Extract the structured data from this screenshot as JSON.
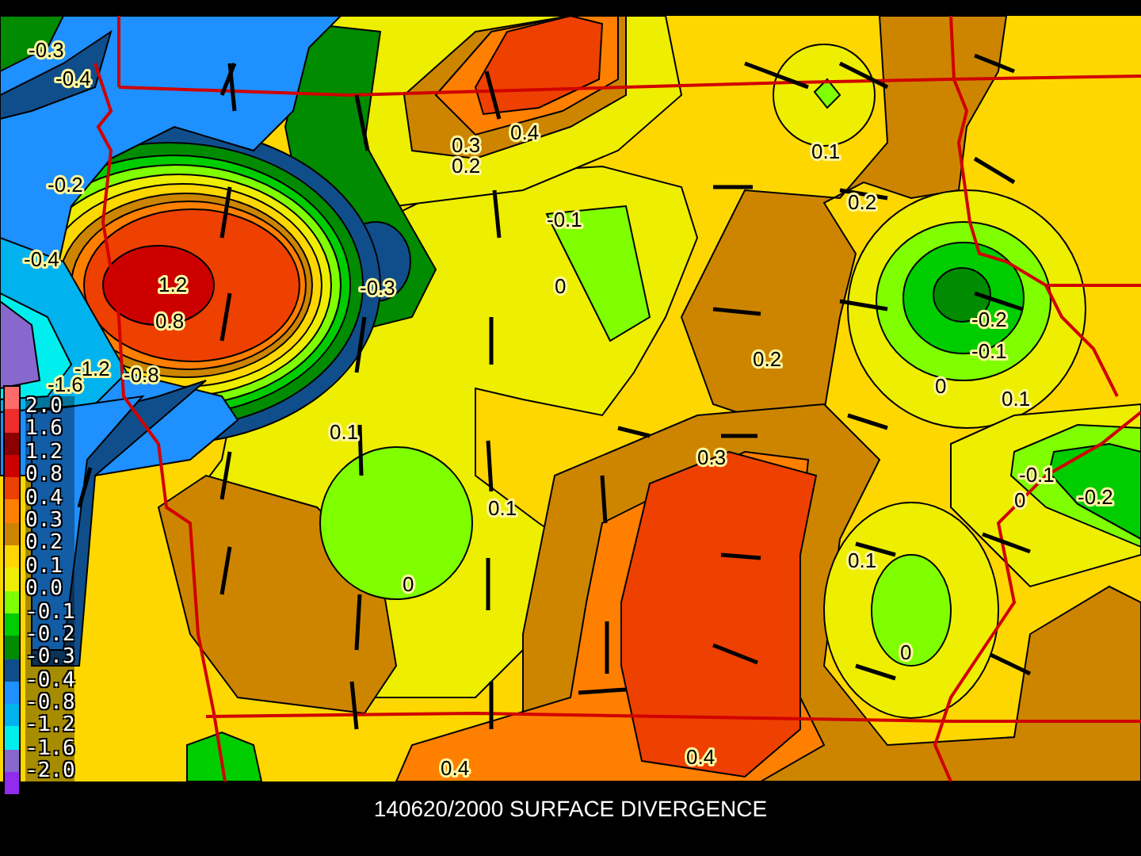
{
  "map": {
    "contour_labels": [
      "-0.3",
      "-0.4",
      "-0.2",
      "-0.4",
      "1.2",
      "0.8",
      "-0.3",
      "0.4",
      "0.3",
      "0.2",
      "-0.1",
      "0",
      "-1.2",
      "-1.6",
      "-0.8",
      "0.1",
      "0.2",
      "-0.2",
      "-0.1",
      "0",
      "0.1",
      "0.2",
      "0.1",
      "0.1",
      "0",
      "0.3",
      "-0.1",
      "0",
      "-0.2",
      "0.1",
      "0",
      "0.4",
      "0.4"
    ]
  },
  "legend": {
    "swatches": [
      {
        "color": "#ff6a6a"
      },
      {
        "color": "#ee2c2c"
      },
      {
        "color": "#8b0000"
      },
      {
        "color": "#cd0000"
      },
      {
        "color": "#ee4000"
      },
      {
        "color": "#ff7f00"
      },
      {
        "color": "#cd8500"
      },
      {
        "color": "#ffd700"
      },
      {
        "color": "#eeee00"
      },
      {
        "color": "#7fff00"
      },
      {
        "color": "#00cd00"
      },
      {
        "color": "#008b00"
      },
      {
        "color": "#104e8b"
      },
      {
        "color": "#1e90ff"
      },
      {
        "color": "#00b2ee"
      },
      {
        "color": "#00eeee"
      },
      {
        "color": "#8968cd"
      },
      {
        "color": "#912cee"
      }
    ],
    "labels": [
      "2.0",
      "1.6",
      "1.2",
      "0.8",
      "0.4",
      "0.3",
      "0.2",
      "0.1",
      "0.0",
      "-0.1",
      "-0.2",
      "-0.3",
      "-0.4",
      "-0.8",
      "-1.2",
      "-1.6",
      "-2.0"
    ]
  },
  "caption": "140620/2000 SURFACE DIVERGENCE"
}
